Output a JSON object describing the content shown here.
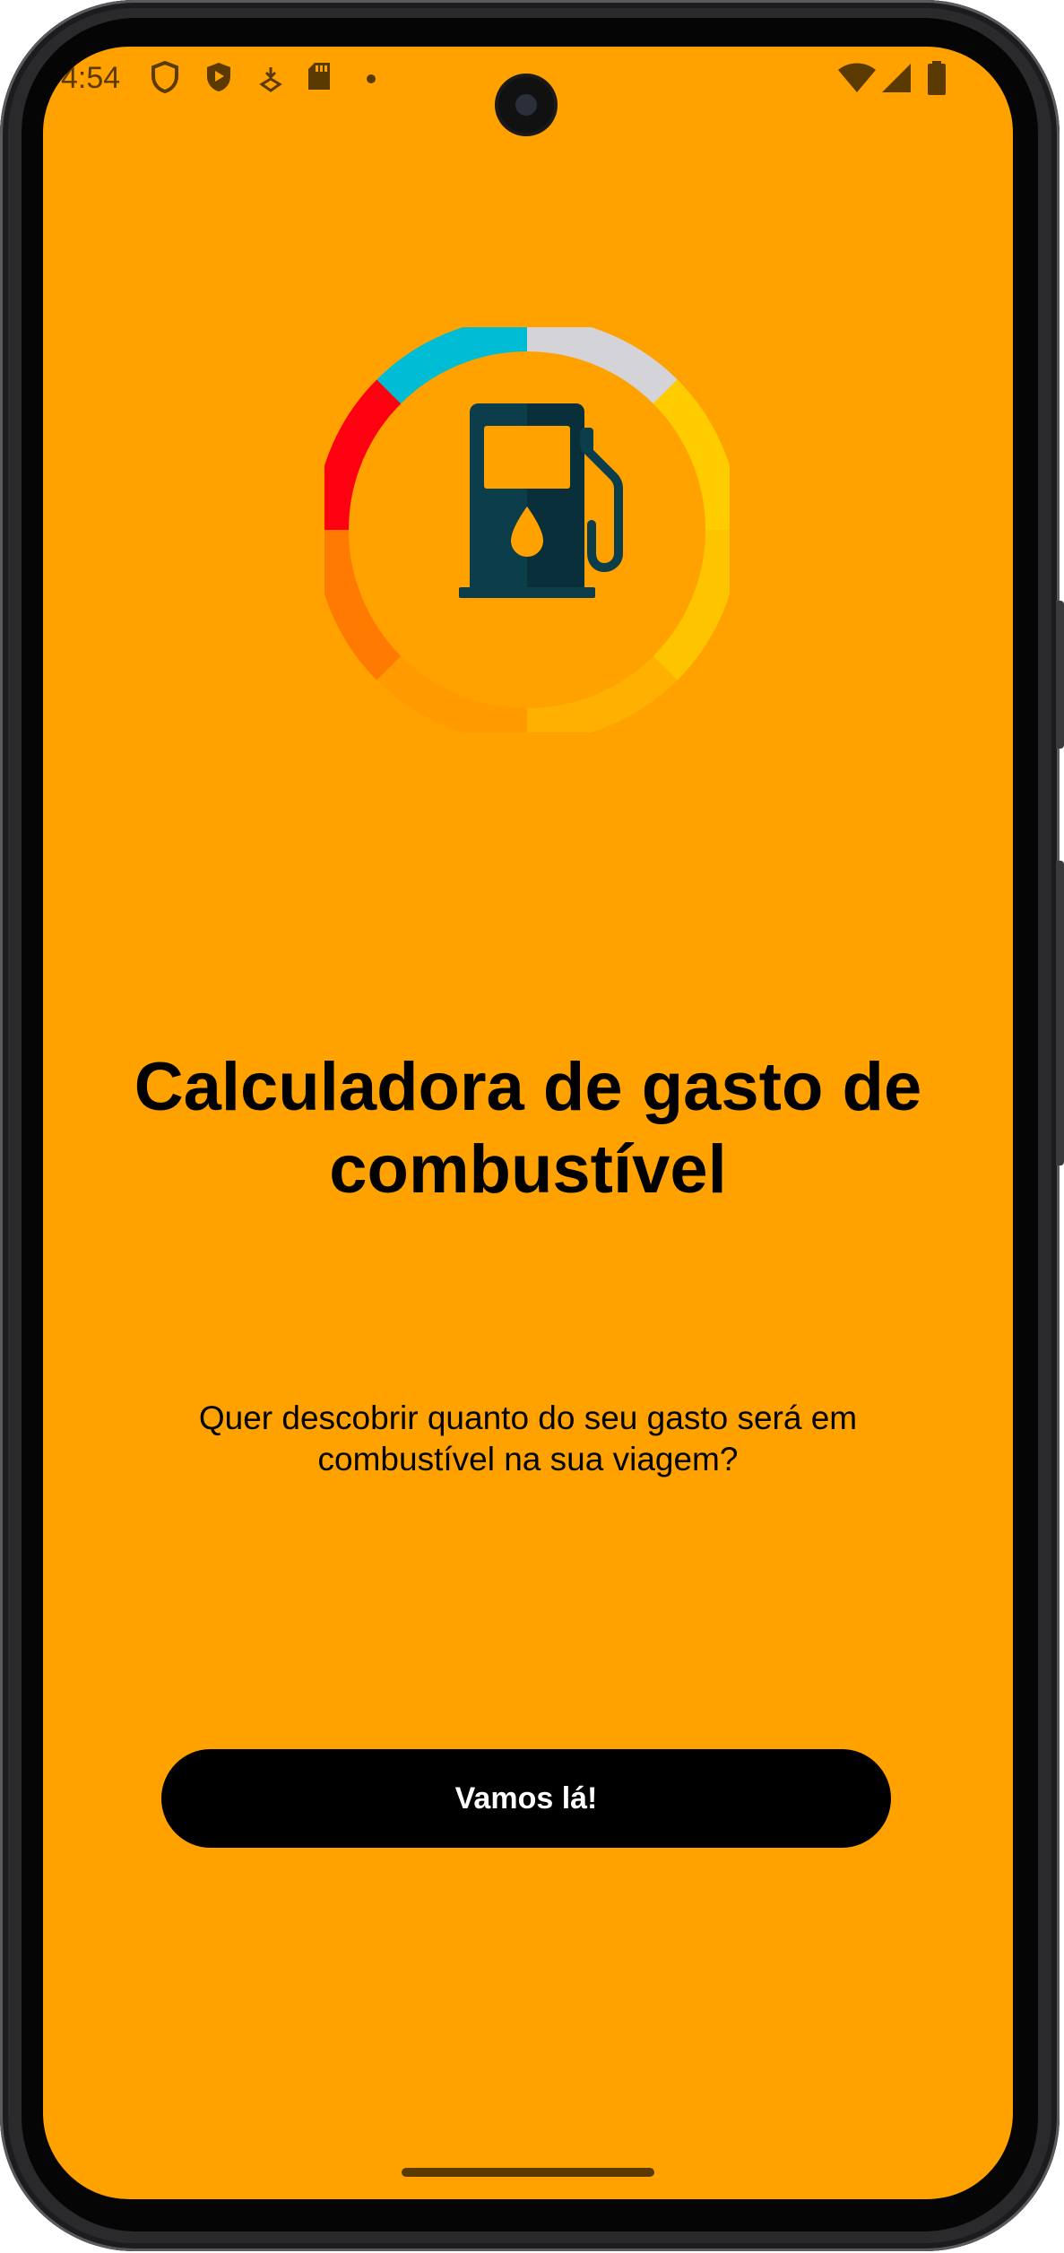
{
  "status_bar": {
    "time": "4:54",
    "left_icons": [
      "shield-outline-icon",
      "shield-play-icon",
      "download-location-icon",
      "sd-card-icon",
      "dot-icon"
    ],
    "right_icons": [
      "wifi-icon",
      "cell-signal-icon",
      "battery-icon"
    ]
  },
  "colors": {
    "background": "#FFA200",
    "button_bg": "#000000",
    "button_text": "#FFFFFF",
    "pump": "#0B3D4A",
    "ring_segments": [
      "#D3D3D8",
      "#FFCC00",
      "#FFC400",
      "#FFB000",
      "#FF9A00",
      "#FF7A00",
      "#FF0010",
      "#00BCD4"
    ]
  },
  "welcome": {
    "logo_icon": "fuel-pump-icon",
    "title": "Calculadora de gasto de combustível",
    "subtitle": "Quer descobrir quanto do seu gasto será em combustível na sua viagem?",
    "start_button": "Vamos lá!"
  }
}
